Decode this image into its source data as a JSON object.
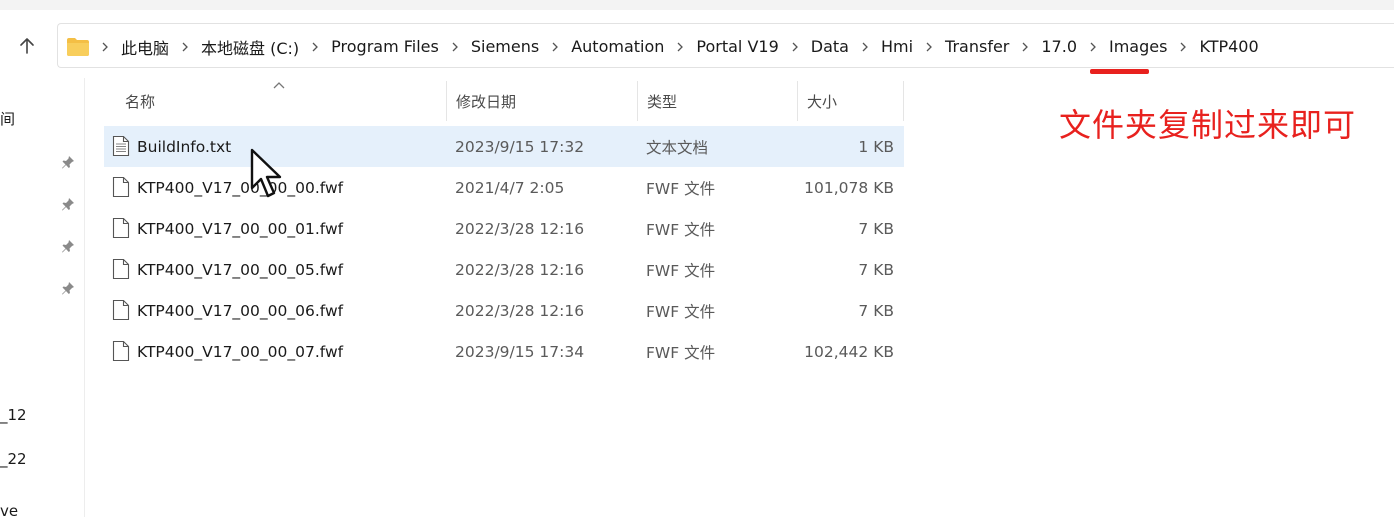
{
  "window": {
    "breadcrumbs": [
      "此电脑",
      "本地磁盘 (C:)",
      "Program Files",
      "Siemens",
      "Automation",
      "Portal V19",
      "Data",
      "Hmi",
      "Transfer",
      "17.0",
      "Images",
      "KTP400"
    ]
  },
  "annotation": {
    "text": "文件夹复制过来即可",
    "color": "#e8211e"
  },
  "nav_fragments": [
    "间",
    "_12",
    "_22",
    "ve"
  ],
  "columns": {
    "name": "名称",
    "date": "修改日期",
    "type": "类型",
    "size": "大小"
  },
  "files": [
    {
      "name": "BuildInfo.txt",
      "date": "2023/9/15 17:32",
      "type": "文本文档",
      "size": "1 KB",
      "icon": "text-file-icon",
      "selected": true
    },
    {
      "name": "KTP400_V17_00_00_00.fwf",
      "date": "2021/4/7 2:05",
      "type": "FWF 文件",
      "size": "101,078 KB",
      "icon": "file-icon"
    },
    {
      "name": "KTP400_V17_00_00_01.fwf",
      "date": "2022/3/28 12:16",
      "type": "FWF 文件",
      "size": "7 KB",
      "icon": "file-icon"
    },
    {
      "name": "KTP400_V17_00_00_05.fwf",
      "date": "2022/3/28 12:16",
      "type": "FWF 文件",
      "size": "7 KB",
      "icon": "file-icon"
    },
    {
      "name": "KTP400_V17_00_00_06.fwf",
      "date": "2022/3/28 12:16",
      "type": "FWF 文件",
      "size": "7 KB",
      "icon": "file-icon"
    },
    {
      "name": "KTP400_V17_00_00_07.fwf",
      "date": "2023/9/15 17:34",
      "type": "FWF 文件",
      "size": "102,442 KB",
      "icon": "file-icon"
    }
  ],
  "colors": {
    "accent": "#e8211e",
    "selection": "#e5f0fb",
    "folder": "#f4bf45"
  }
}
